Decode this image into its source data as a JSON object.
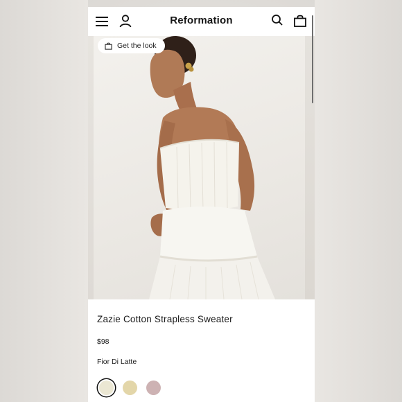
{
  "header": {
    "brand": "Reformation",
    "icons": [
      "menu-icon",
      "account-icon",
      "search-icon",
      "bag-icon"
    ]
  },
  "gallery": {
    "get_the_look_label": "Get the look",
    "image_description_icon": "model-photo"
  },
  "product": {
    "title": "Zazie Cotton Strapless Sweater",
    "price": "$98",
    "color_name": "Fior Di Latte",
    "swatches": [
      {
        "color": "#ebe7d3",
        "selected": true
      },
      {
        "color": "#e3d6a9",
        "selected": false
      },
      {
        "color": "#cdb2b3",
        "selected": false
      }
    ]
  }
}
